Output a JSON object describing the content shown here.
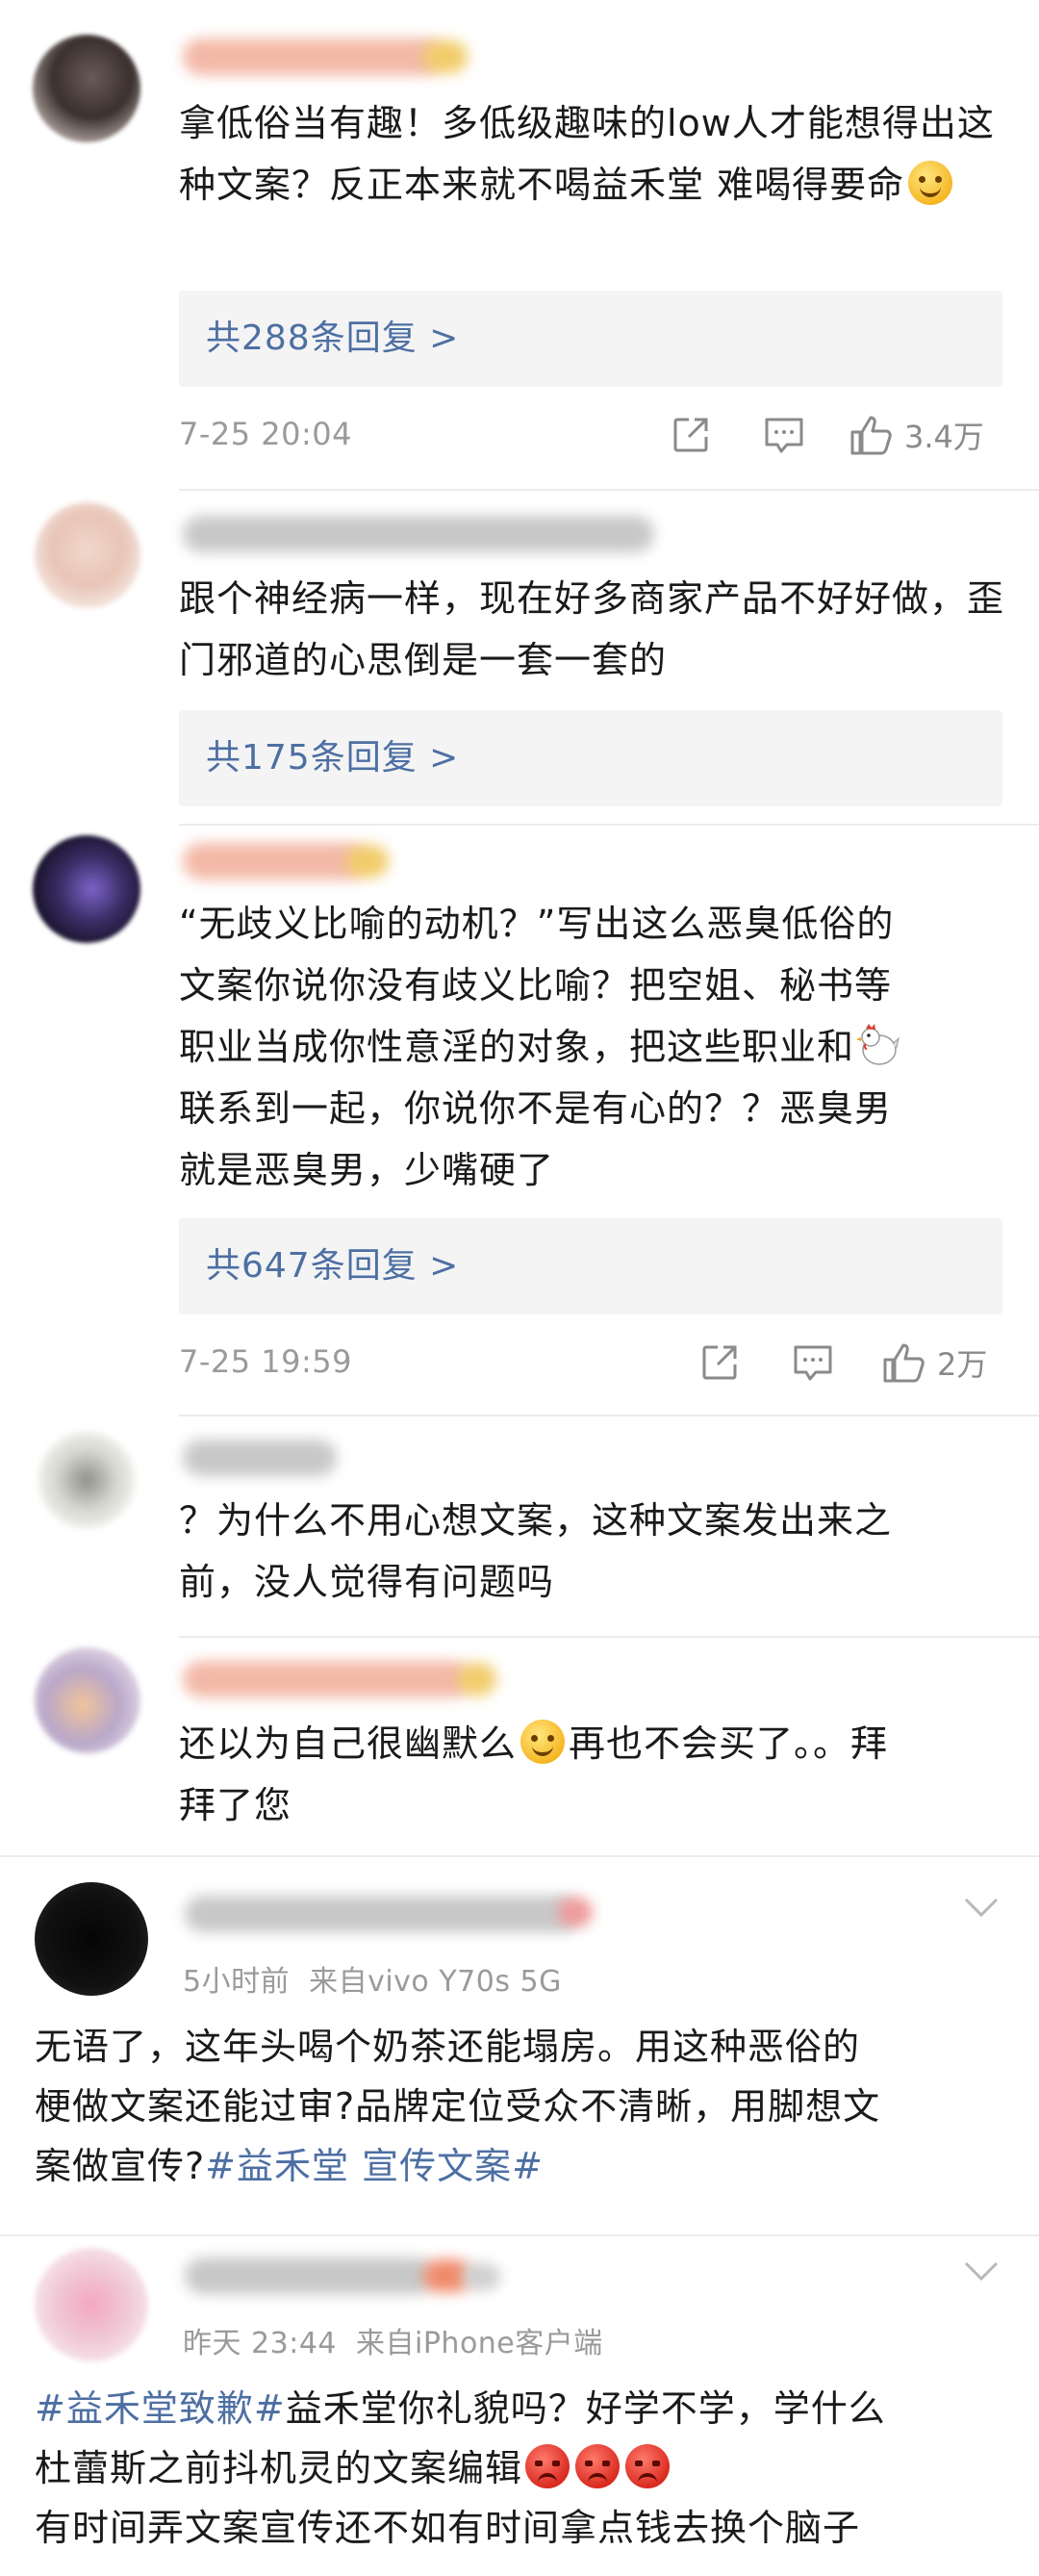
{
  "comments": [
    {
      "text_parts": [
        "拿低俗当有趣！多低级趣味的low人才能想得出这种文案？反正本来就不喝益禾堂 难喝得要命"
      ],
      "reply_link": "共288条回复 >",
      "date": "7-25 20:04",
      "like_count": "3.4万"
    },
    {
      "text_parts": [
        "跟个神经病一样，现在好多商家产品不好好做，歪门邪道的心思倒是一套一套的"
      ],
      "reply_link": "共175条回复 >"
    },
    {
      "text_line1": "“无歧义比喻的动机？”写出这么恶臭低俗的",
      "text_line2": "文案你说你没有歧义比喻？把空姐、秘书等",
      "text_line3": "职业当成你性意淫的对象，把这些职业和",
      "text_line4": "联系到一起，你说你不是有心的？？恶臭男",
      "text_line5": "就是恶臭男，少嘴硬了",
      "reply_link": "共647条回复 >",
      "date": "7-25 19:59",
      "like_count": "2万"
    },
    {
      "text_line1": "？为什么不用心想文案，这种文案发出来之",
      "text_line2": "前，没人觉得有问题吗"
    },
    {
      "text_before_emoji": "还以为自己很幽默么",
      "text_after_emoji": "再也不会买了。。拜",
      "text_line2": "拜了您"
    }
  ],
  "posts": [
    {
      "meta_time": "5小时前",
      "meta_source": "来自vivo Y70s 5G",
      "line1": "无语了，这年头喝个奶茶还能塌房。用这种恶俗的",
      "line2": "梗做文案还能过审?品牌定位受众不清晰，用脚想文",
      "line3_plain": "案做宣传?",
      "line3_tag": "#益禾堂 宣传文案#"
    },
    {
      "meta_time": "昨天 23:44",
      "meta_source": "来自iPhone客户端",
      "line1_tag": "#益禾堂致歉#",
      "line1_plain": "益禾堂你礼貌吗？好学不学，学什么",
      "line2": "杜蕾斯之前抖机灵的文案编辑",
      "line3": "有时间弄文案宣传还不如有时间拿点钱去换个脑子"
    }
  ],
  "icons": {
    "share": "share-icon",
    "comment": "comment-icon",
    "like": "thumbs-up-icon",
    "chevron": "chevron-down-icon"
  },
  "colors": {
    "link": "#4d6fa3",
    "meta": "#9a9a9a",
    "reply_bg": "#f4f4f4"
  }
}
